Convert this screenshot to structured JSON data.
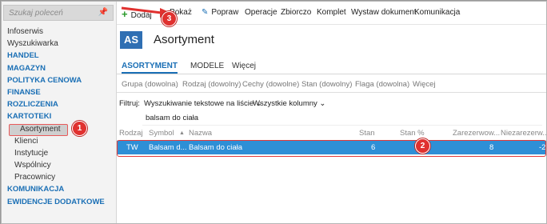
{
  "sidebar": {
    "search_placeholder": "Szukaj poleceń",
    "pin_icon": "pin-icon",
    "items": [
      {
        "label": "Infoserwis",
        "kind": "plain"
      },
      {
        "label": "Wyszukiwarka",
        "kind": "plain"
      },
      {
        "label": "HANDEL",
        "kind": "group"
      },
      {
        "label": "MAGAZYN",
        "kind": "group"
      },
      {
        "label": "POLITYKA CENOWA",
        "kind": "group"
      },
      {
        "label": "FINANSE",
        "kind": "group"
      },
      {
        "label": "ROZLICZENIA",
        "kind": "group"
      },
      {
        "label": "KARTOTEKI",
        "kind": "group"
      },
      {
        "label": "Asortyment",
        "kind": "active"
      },
      {
        "label": "Klienci",
        "kind": "sub"
      },
      {
        "label": "Instytucje",
        "kind": "sub"
      },
      {
        "label": "Wspólnicy",
        "kind": "sub"
      },
      {
        "label": "Pracownicy",
        "kind": "sub"
      },
      {
        "label": "KOMUNIKACJA",
        "kind": "group"
      },
      {
        "label": "EWIDENCJE DODATKOWE",
        "kind": "group"
      }
    ]
  },
  "toolbar": {
    "add": "Dodaj",
    "show": "Pokaż",
    "fix": "Popraw",
    "ops": "Operacje",
    "bulk": "Zbiorczo",
    "set": "Komplet",
    "issue": "Wystaw dokument",
    "comm": "Komunikacja"
  },
  "header": {
    "badge": "AS",
    "title": "Asortyment"
  },
  "tabs": [
    "ASORTYMENT",
    "MODELE",
    "Więcej"
  ],
  "groups": [
    "Grupa (dowolna)",
    "Rodzaj (dowolny)",
    "Cechy (dowolne)",
    "Stan (dowolny)",
    "Flaga (dowolna)",
    "Więcej"
  ],
  "filter": {
    "label": "Filtruj:",
    "mode": "Wyszukiwanie tekstowe na liście ⌄",
    "columns": "Wszystkie kolumny ⌄",
    "search_value": "balsam do ciała"
  },
  "table": {
    "headers": [
      "Rodzaj",
      "Symbol",
      "▲",
      "Nazwa",
      "Stan",
      "Stan %",
      "Zarezerwow...",
      "Niezarezerw..."
    ],
    "row": {
      "rodzaj": "TW",
      "symbol": "Balsam d...",
      "nazwa": "Balsam do ciała",
      "stan": "6",
      "stan_pct": "",
      "zarez": "8",
      "niezarez": "-2"
    }
  },
  "annotations": [
    "1",
    "2",
    "3"
  ],
  "colors": {
    "accent": "#1a6fb5",
    "selection": "#2e8fd6",
    "annotation": "#e0312f"
  }
}
